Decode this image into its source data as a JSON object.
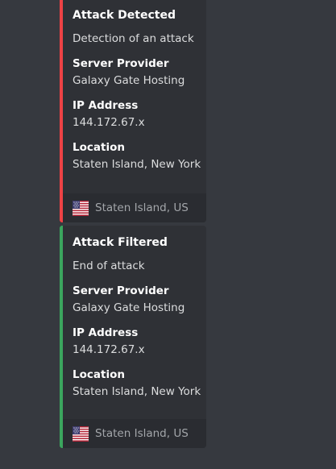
{
  "embeds": [
    {
      "title": "Attack Detected",
      "description": "Detection of an attack",
      "accent_color": "#ed4245",
      "fields": [
        {
          "name": "Server Provider",
          "value": "Galaxy Gate Hosting"
        },
        {
          "name": "IP Address",
          "value": "144.172.67.x"
        },
        {
          "name": "Location",
          "value": "Staten Island, New York"
        }
      ],
      "footer": {
        "icon": "us-flag-icon",
        "text": "Staten Island, US"
      }
    },
    {
      "title": "Attack Filtered",
      "description": "End of attack",
      "accent_color": "#3ba55d",
      "fields": [
        {
          "name": "Server Provider",
          "value": "Galaxy Gate Hosting"
        },
        {
          "name": "IP Address",
          "value": "144.172.67.x"
        },
        {
          "name": "Location",
          "value": "Staten Island, New York"
        }
      ],
      "footer": {
        "icon": "us-flag-icon",
        "text": "Staten Island, US"
      }
    }
  ]
}
